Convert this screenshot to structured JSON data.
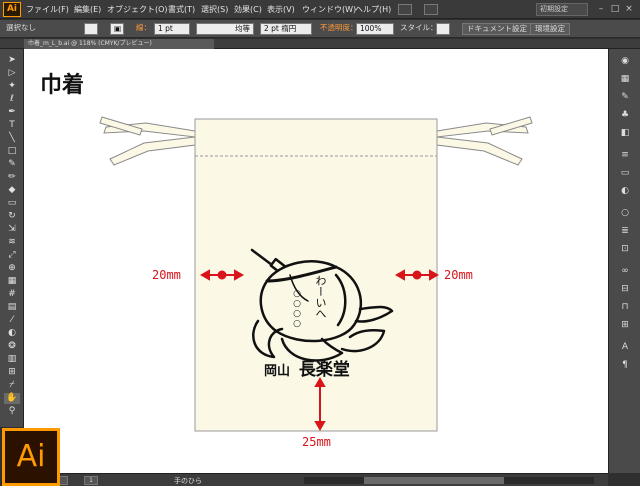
{
  "app": {
    "logo_text": "Ai",
    "menus": [
      "ファイル(F)",
      "編集(E)",
      "オブジェクト(O)",
      "書式(T)",
      "選択(S)",
      "効果(C)",
      "表示(V)",
      "ウィンドウ(W)",
      "ヘルプ(H)"
    ],
    "workspace": "初期設定",
    "window_controls": [
      "–",
      "□",
      "×"
    ]
  },
  "control_bar": {
    "selection_status": "選択なし",
    "stroke_label": "線：",
    "stroke_weight": "1 pt",
    "stroke_profile": "均等",
    "brush": "2 pt 楕円",
    "opacity_label": "不透明度：",
    "opacity_value": "100%",
    "style_label": "スタイル：",
    "doc_settings_button": "ドキュメント設定",
    "prefs_button": "環境設定"
  },
  "document_tab": "巾着_m_L_b.ai @ 118% (CMYK/プレビュー)",
  "artwork": {
    "heading": "巾着",
    "margin_left": "20mm",
    "margin_right": "20mm",
    "margin_bottom": "25mm",
    "logo_vertical_text": "わーいへ",
    "logo_circle_text": "○○○○",
    "brand_left": "岡山",
    "brand_right": "長楽堂",
    "colors": {
      "bag": "#fbf8e6",
      "arrow": "#d9141b",
      "ink": "#111111"
    }
  },
  "status_bar": {
    "zoom": "118%",
    "page": "1",
    "current_tool": "手のひら"
  },
  "tool_icons": [
    "selection-icon",
    "direct-selection-icon",
    "magic-wand-icon",
    "lasso-icon",
    "pen-icon",
    "type-icon",
    "line-icon",
    "rectangle-icon",
    "paintbrush-icon",
    "pencil-icon",
    "blob-brush-icon",
    "eraser-icon",
    "rotate-icon",
    "scale-icon",
    "warp-icon",
    "free-transform-icon",
    "shape-builder-icon",
    "perspective-icon",
    "mesh-icon",
    "gradient-icon",
    "eyedropper-icon",
    "blend-icon",
    "symbol-sprayer-icon",
    "graph-icon",
    "artboard-icon",
    "slice-icon",
    "hand-icon",
    "zoom-icon"
  ],
  "dock_icons": [
    "color-icon",
    "swatches-icon",
    "brushes-icon",
    "symbols-icon",
    "graphic-styles-icon",
    "stroke-icon",
    "gradient-panel-icon",
    "transparency-icon",
    "appearance-icon",
    "layers-icon",
    "artboards-icon",
    "links-icon",
    "align-icon",
    "pathfinder-icon",
    "transform-icon",
    "character-icon",
    "paragraph-icon"
  ]
}
